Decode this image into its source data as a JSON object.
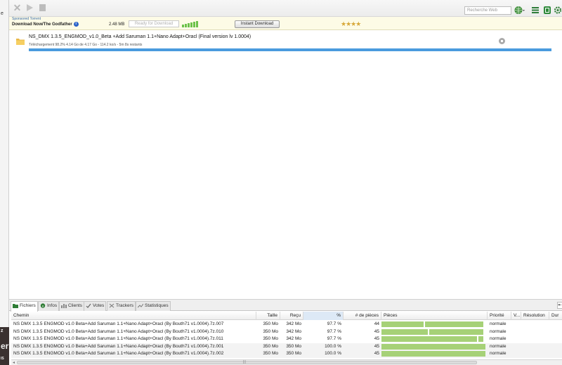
{
  "left_strip": {
    "text": "e",
    "dark_lines": [
      "z",
      "er",
      "IS"
    ]
  },
  "toolbar": {
    "search_placeholder": "Recherche Web",
    "icons": [
      "close-icon",
      "play-icon",
      "pause-icon",
      "globe-icon",
      "list-icon",
      "notepad-icon",
      "settings-icon"
    ]
  },
  "banner": {
    "sponsored": "Sponsored Torrent",
    "title": "Download Now/The Godfather",
    "size": "2.48 MB",
    "ready": "Ready for Download",
    "button": "Instant Download",
    "stars": "★★★★",
    "stars_value": 4
  },
  "torrent": {
    "name": "NS_DMX 1.3.5_ENGMOD_v1.0_Beta +Add Saruman 1.1+Nano Adapt+Oracl (Final version lv 1.0004)",
    "status": "Téléchargement 98.2% 4.14 Go de 4.17 Go - 114.2 ko/s - 5m 8s restants",
    "progress": 0.982
  },
  "tabs": [
    {
      "label": "Fichiers",
      "icon": "folder-icon"
    },
    {
      "label": "Infos",
      "icon": "info-icon"
    },
    {
      "label": "Clients",
      "icon": "clients-icon"
    },
    {
      "label": "Votes",
      "icon": "votes-icon"
    },
    {
      "label": "Trackers",
      "icon": "trackers-icon"
    },
    {
      "label": "Statistiques",
      "icon": "stats-icon"
    }
  ],
  "table": {
    "headers": {
      "path": "Chemin",
      "size": "Taille",
      "recv": "Reçu",
      "pct": "%",
      "pieces_n": "# de pièces",
      "pieces": "Pièces",
      "priority": "Priorité",
      "v": "V...",
      "resolution": "Résolution",
      "dur": "Dur"
    },
    "rows": [
      {
        "path": "NS DMX 1.3.5 ENGMOD v1.0 Beta+Add Saruman 1.1+Nano Adapt+Oracl (By Bouth71 v1.0004).7z.007",
        "size": "350 Mo",
        "recv": "342 Mo",
        "pct": "97.7 %",
        "pieces": "44",
        "priority": "normale",
        "completion": 0.977
      },
      {
        "path": "NS DMX 1.3.5 ENGMOD v1.0 Beta+Add Saruman 1.1+Nano Adapt+Oracl (By Bouth71 v1.0004).7z.010",
        "size": "350 Mo",
        "recv": "342 Mo",
        "pct": "97.7 %",
        "pieces": "45",
        "priority": "normale",
        "completion": 0.977
      },
      {
        "path": "NS DMX 1.3.5 ENGMOD v1.0 Beta+Add Saruman 1.1+Nano Adapt+Oracl (By Bouth71 v1.0004).7z.011",
        "size": "350 Mo",
        "recv": "342 Mo",
        "pct": "97.7 %",
        "pieces": "45",
        "priority": "normale",
        "completion": 0.977
      },
      {
        "path": "NS DMX 1.3.5 ENGMOD v1.0 Beta+Add Saruman 1.1+Nano Adapt+Oracl (By Bouth71 v1.0004).7z.001",
        "size": "350 Mo",
        "recv": "350 Mo",
        "pct": "100.0 %",
        "pieces": "45",
        "priority": "normale",
        "completion": 1.0
      },
      {
        "path": "NS DMX 1.3.5 ENGMOD v1.0 Beta+Add Saruman 1.1+Nano Adapt+Oracl (By Bouth71 v1.0004).7z.002",
        "size": "350 Mo",
        "recv": "350 Mo",
        "pct": "100.0 %",
        "pieces": "45",
        "priority": "normale",
        "completion": 1.0
      }
    ]
  },
  "colors": {
    "progress": "#4a9bde",
    "pieces": "#a6d177",
    "stars": "#d7a83a",
    "banner_bg": "#fdfbe6"
  }
}
